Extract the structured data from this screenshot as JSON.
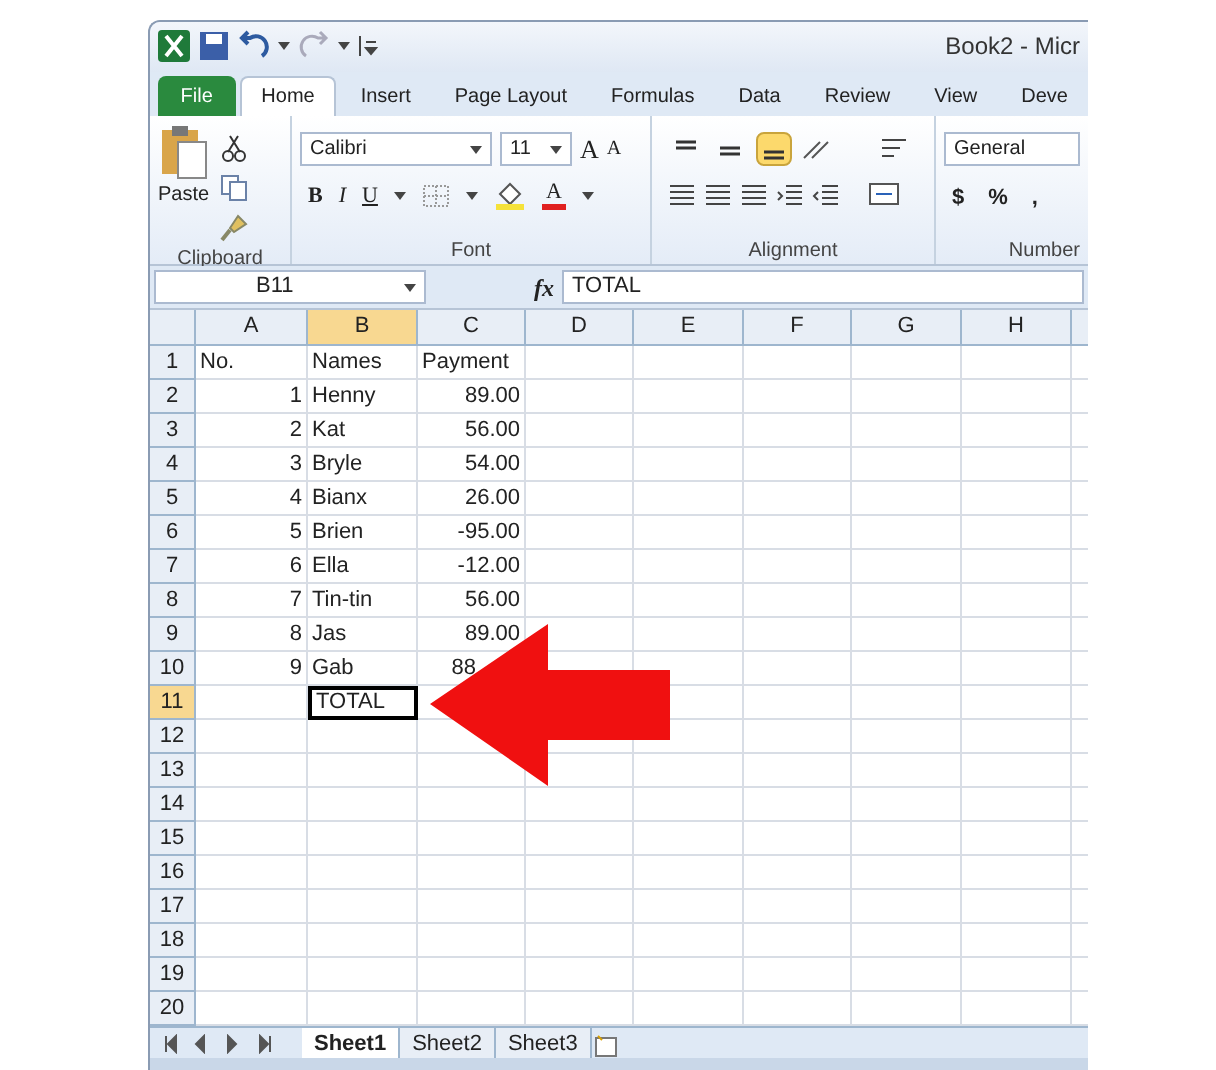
{
  "title_bar": {
    "title": "Book2 - Micr"
  },
  "ribbon_tabs": [
    {
      "label": "File",
      "kind": "file",
      "selected": false
    },
    {
      "label": "Home",
      "kind": "tab",
      "selected": true
    },
    {
      "label": "Insert",
      "kind": "tab",
      "selected": false
    },
    {
      "label": "Page Layout",
      "kind": "tab",
      "selected": false
    },
    {
      "label": "Formulas",
      "kind": "tab",
      "selected": false
    },
    {
      "label": "Data",
      "kind": "tab",
      "selected": false
    },
    {
      "label": "Review",
      "kind": "tab",
      "selected": false
    },
    {
      "label": "View",
      "kind": "tab",
      "selected": false
    },
    {
      "label": "Deve",
      "kind": "tab",
      "selected": false
    }
  ],
  "clipboard": {
    "paste_label": "Paste",
    "group_label": "Clipboard"
  },
  "font": {
    "name": "Calibri",
    "size": "11",
    "grow": "A",
    "shrink": "A",
    "styles": [
      "B",
      "I",
      "U"
    ],
    "color_label": "A",
    "group_label": "Font"
  },
  "alignment": {
    "vertical": [
      {
        "selected": false
      },
      {
        "selected": false
      },
      {
        "selected": true
      }
    ],
    "group_label": "Alignment"
  },
  "number": {
    "format": "General",
    "buttons": [
      "$",
      "%",
      ","
    ],
    "group_label": "Number"
  },
  "formula_bar": {
    "name_box": "B11",
    "fx": "fx",
    "formula": "TOTAL"
  },
  "columns": [
    {
      "label": "A",
      "selected": false
    },
    {
      "label": "B",
      "selected": true
    },
    {
      "label": "C",
      "selected": false
    },
    {
      "label": "D",
      "selected": false
    },
    {
      "label": "E",
      "selected": false
    },
    {
      "label": "F",
      "selected": false
    },
    {
      "label": "G",
      "selected": false
    },
    {
      "label": "H",
      "selected": false
    }
  ],
  "rows": [
    {
      "header": "1",
      "selected": false,
      "cells": [
        {
          "text": "No.",
          "kind": "text",
          "selected": false
        },
        {
          "text": "Names",
          "kind": "text",
          "selected": false
        },
        {
          "text": "Payment",
          "kind": "text",
          "selected": false
        }
      ]
    },
    {
      "header": "2",
      "selected": false,
      "cells": [
        {
          "text": "1",
          "kind": "number",
          "selected": false
        },
        {
          "text": "Henny",
          "kind": "text",
          "selected": false
        },
        {
          "text": "89.00",
          "kind": "number",
          "selected": false
        }
      ]
    },
    {
      "header": "3",
      "selected": false,
      "cells": [
        {
          "text": "2",
          "kind": "number",
          "selected": false
        },
        {
          "text": "Kat",
          "kind": "text",
          "selected": false
        },
        {
          "text": "56.00",
          "kind": "number",
          "selected": false
        }
      ]
    },
    {
      "header": "4",
      "selected": false,
      "cells": [
        {
          "text": "3",
          "kind": "number",
          "selected": false
        },
        {
          "text": "Bryle",
          "kind": "text",
          "selected": false
        },
        {
          "text": "54.00",
          "kind": "number",
          "selected": false
        }
      ]
    },
    {
      "header": "5",
      "selected": false,
      "cells": [
        {
          "text": "4",
          "kind": "number",
          "selected": false
        },
        {
          "text": "Bianx",
          "kind": "text",
          "selected": false
        },
        {
          "text": "26.00",
          "kind": "number",
          "selected": false
        }
      ]
    },
    {
      "header": "6",
      "selected": false,
      "cells": [
        {
          "text": "5",
          "kind": "number",
          "selected": false
        },
        {
          "text": "Brien",
          "kind": "text",
          "selected": false
        },
        {
          "text": "-95.00",
          "kind": "number",
          "selected": false
        }
      ]
    },
    {
      "header": "7",
      "selected": false,
      "cells": [
        {
          "text": "6",
          "kind": "number",
          "selected": false
        },
        {
          "text": "Ella",
          "kind": "text",
          "selected": false
        },
        {
          "text": "-12.00",
          "kind": "number",
          "selected": false
        }
      ]
    },
    {
      "header": "8",
      "selected": false,
      "cells": [
        {
          "text": "7",
          "kind": "number",
          "selected": false
        },
        {
          "text": "Tin-tin",
          "kind": "text",
          "selected": false
        },
        {
          "text": "56.00",
          "kind": "number",
          "selected": false
        }
      ]
    },
    {
      "header": "9",
      "selected": false,
      "cells": [
        {
          "text": "8",
          "kind": "number",
          "selected": false
        },
        {
          "text": "Jas",
          "kind": "text",
          "selected": false
        },
        {
          "text": "89.00",
          "kind": "number",
          "selected": false
        }
      ]
    },
    {
      "header": "10",
      "selected": false,
      "cells": [
        {
          "text": "9",
          "kind": "number",
          "selected": false
        },
        {
          "text": "Gab",
          "kind": "text",
          "selected": false
        },
        {
          "text": "88",
          "kind": "covered",
          "selected": false
        }
      ]
    },
    {
      "header": "11",
      "selected": true,
      "cells": [
        {
          "kind": "empty",
          "selected": false
        },
        {
          "text": "TOTAL",
          "kind": "text",
          "selected": true
        }
      ]
    },
    {
      "header": "12",
      "selected": false,
      "cells": []
    },
    {
      "header": "13",
      "selected": false,
      "cells": []
    },
    {
      "header": "14",
      "selected": false,
      "cells": []
    },
    {
      "header": "15",
      "selected": false,
      "cells": []
    },
    {
      "header": "16",
      "selected": false,
      "cells": []
    },
    {
      "header": "17",
      "selected": false,
      "cells": []
    },
    {
      "header": "18",
      "selected": false,
      "cells": []
    },
    {
      "header": "19",
      "selected": false,
      "cells": []
    },
    {
      "header": "20",
      "selected": false,
      "cells": []
    }
  ],
  "sheet_tabs": [
    {
      "label": "Sheet1",
      "selected": true
    },
    {
      "label": "Sheet2",
      "selected": false
    },
    {
      "label": "Sheet3",
      "selected": false
    }
  ]
}
